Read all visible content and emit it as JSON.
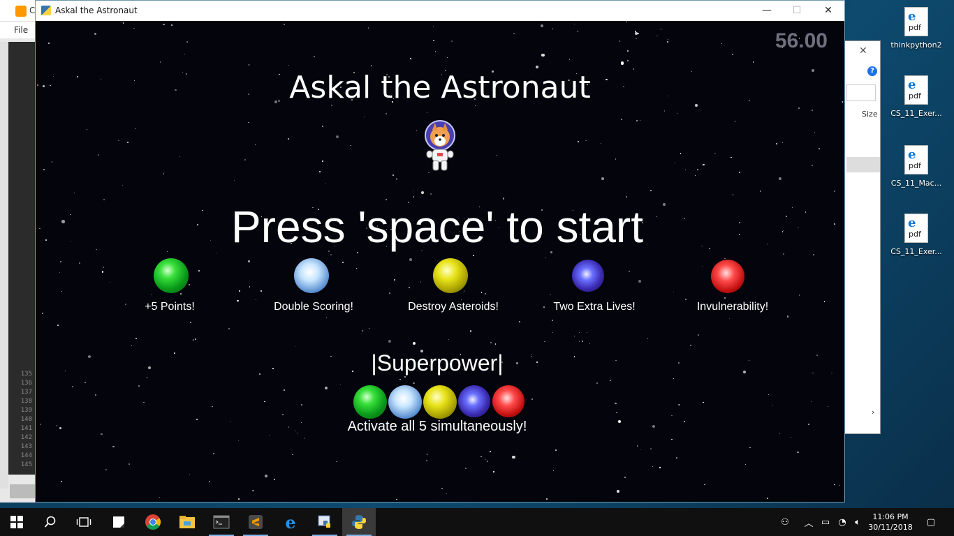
{
  "window": {
    "title": "Askal the Astronaut",
    "minimize": "—",
    "maximize": "☐",
    "close": "✕"
  },
  "game": {
    "timer": "56.00",
    "title": "Askal the Astronaut",
    "prompt": "Press 'space' to start",
    "powerups": [
      {
        "color": "green",
        "label": "+5 Points!"
      },
      {
        "color": "blue",
        "label": "Double Scoring!"
      },
      {
        "color": "yellow",
        "label": "Destroy Asteroids!"
      },
      {
        "color": "purple",
        "label": "Two Extra Lives!"
      },
      {
        "color": "red",
        "label": "Invulnerability!"
      }
    ],
    "superpower_title": "|Superpower|",
    "superpower_desc": "Activate all 5 simultaneously!"
  },
  "editor": {
    "title_fragment": "C",
    "menu_fragment": "File",
    "line_numbers": [
      "135",
      "136",
      "137",
      "138",
      "139",
      "140",
      "141",
      "142",
      "143",
      "144",
      "145"
    ]
  },
  "explorer": {
    "size_header": "Size"
  },
  "desktop_icons": [
    {
      "name": "thinkpython2",
      "type": "pdf"
    },
    {
      "name": "CS_11_Exer...",
      "type": "pdf"
    },
    {
      "name": "CS_11_Mac...",
      "type": "pdf"
    },
    {
      "name": "CS_11_Exer...",
      "type": "pdf"
    }
  ],
  "taskbar": {
    "apps": [
      "start-icon",
      "search-icon",
      "task-view-icon",
      "sticky-notes-icon",
      "chrome-icon",
      "file-explorer-icon",
      "terminal-icon",
      "sublime-text-icon",
      "edge-icon",
      "python-idle-icon",
      "python-icon"
    ],
    "clock_time": "11:06 PM",
    "clock_date": "30/11/2018"
  },
  "colors": {
    "space_bg": "#04040c",
    "timer": "#6f6f7e",
    "taskbar": "#101010"
  }
}
